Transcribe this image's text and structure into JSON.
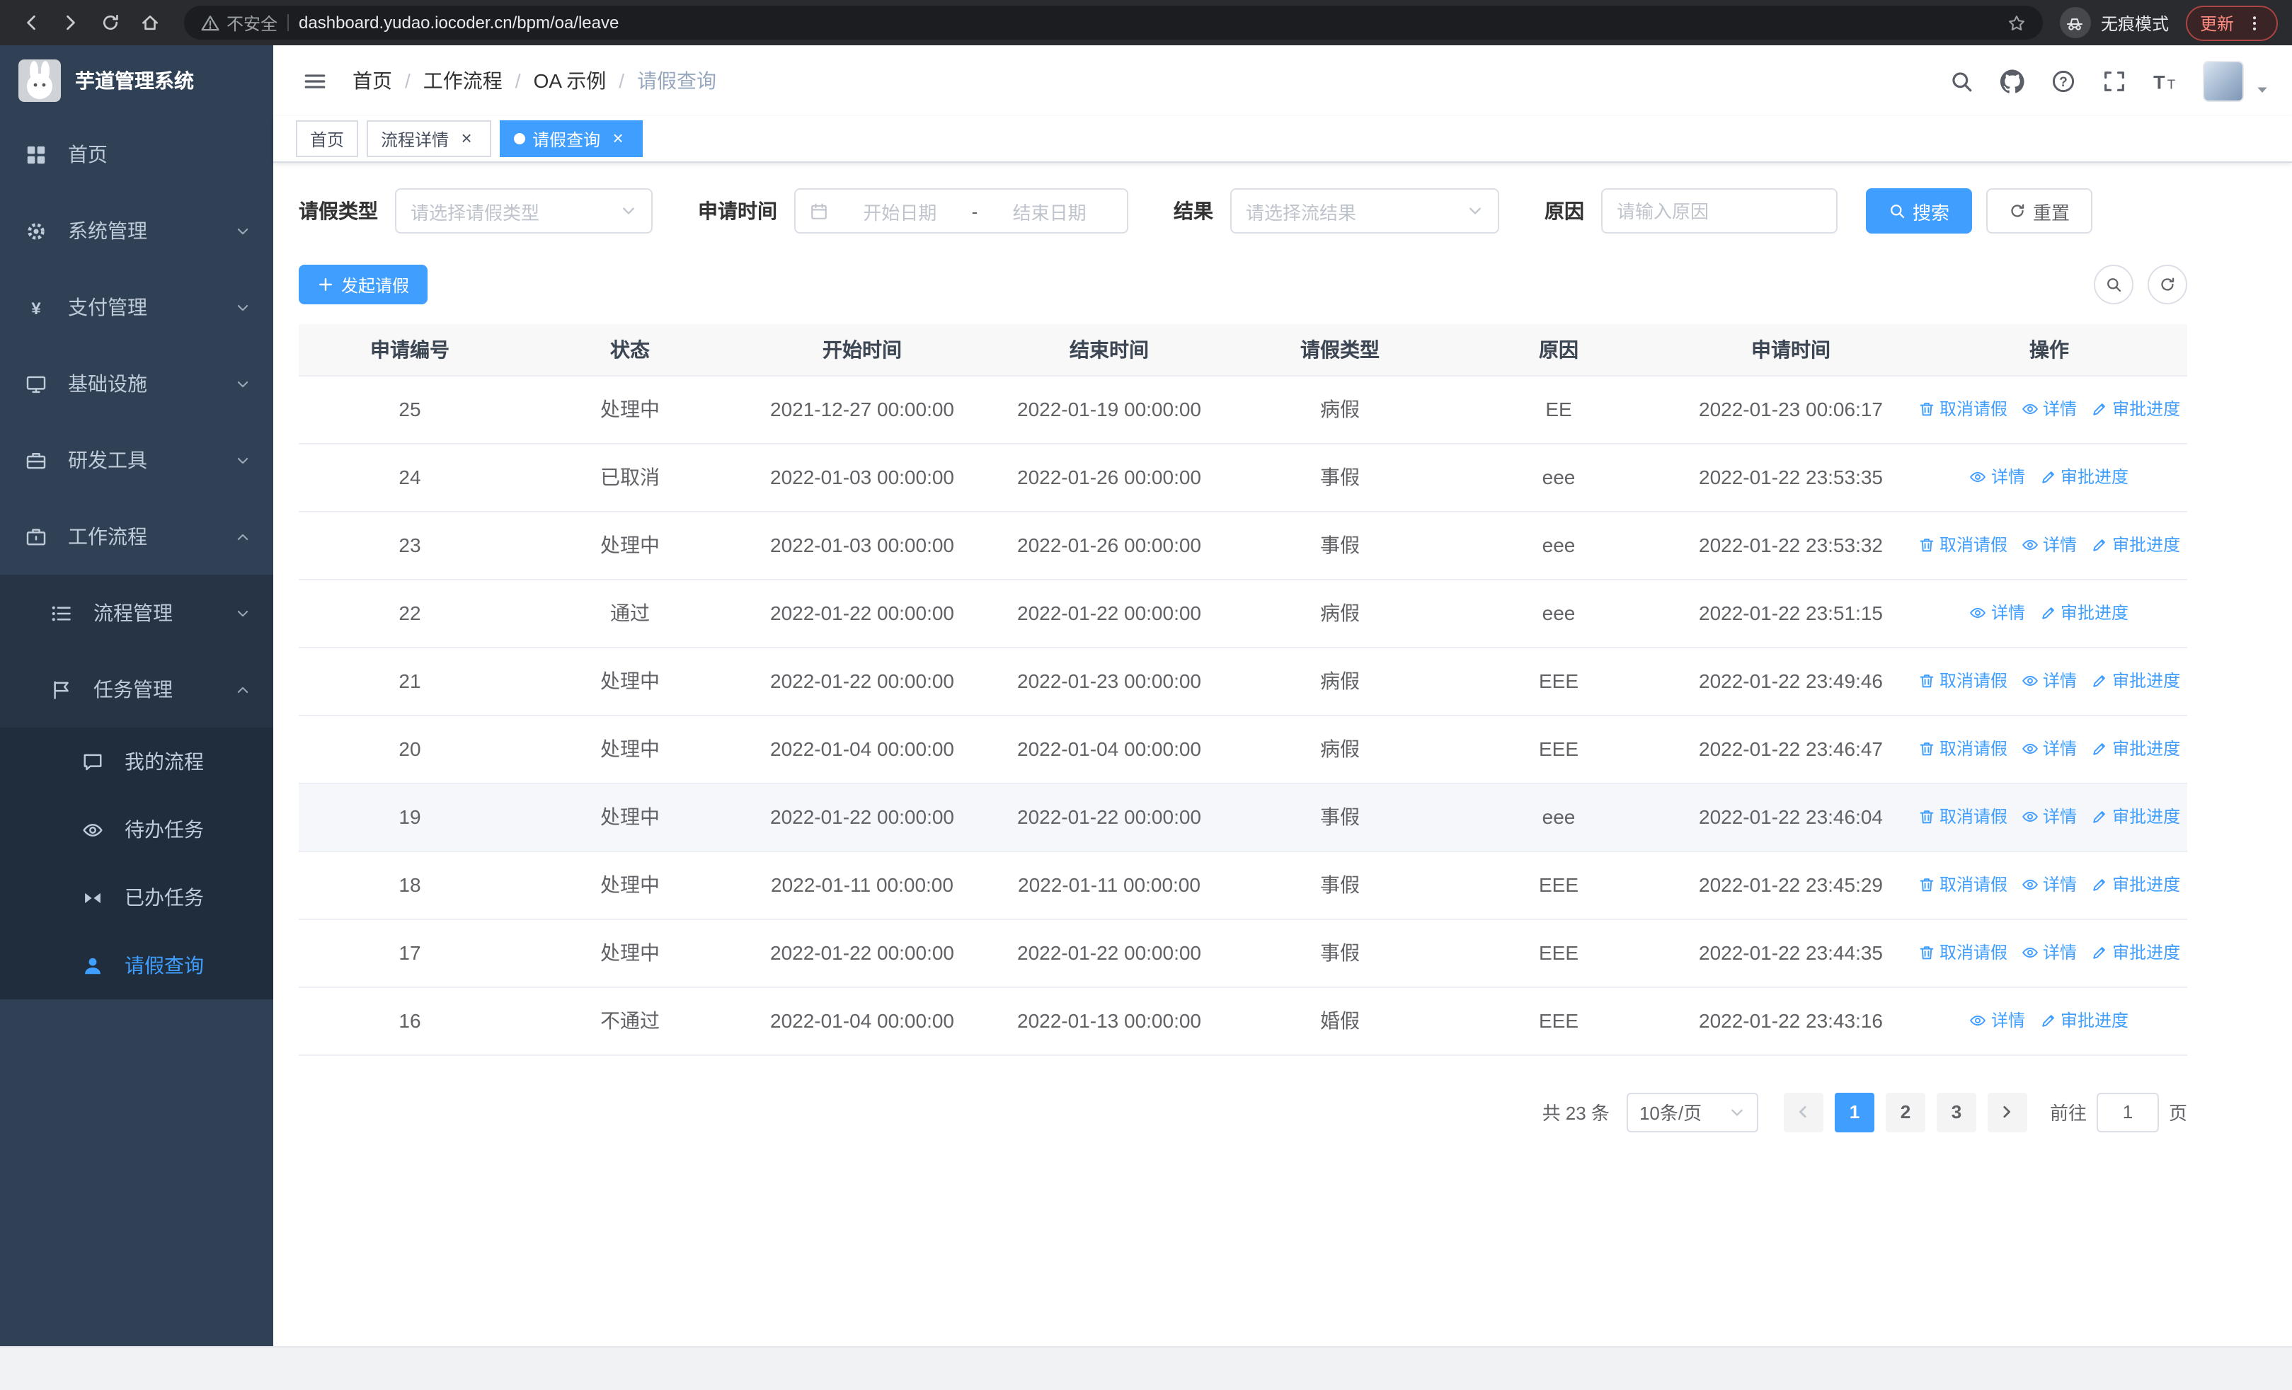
{
  "browser": {
    "security_label": "不安全",
    "url": "dashboard.yudao.iocoder.cn/bpm/oa/leave",
    "incognito_label": "无痕模式",
    "update_label": "更新"
  },
  "sidebar": {
    "logo_title": "芋道管理系统",
    "items": [
      {
        "label": "首页"
      },
      {
        "label": "系统管理"
      },
      {
        "label": "支付管理"
      },
      {
        "label": "基础设施"
      },
      {
        "label": "研发工具"
      },
      {
        "label": "工作流程"
      }
    ],
    "workflow_children": [
      {
        "label": "流程管理"
      },
      {
        "label": "任务管理"
      }
    ],
    "task_children": [
      {
        "label": "我的流程"
      },
      {
        "label": "待办任务"
      },
      {
        "label": "已办任务"
      },
      {
        "label": "请假查询"
      }
    ]
  },
  "header": {
    "breadcrumb": [
      "首页",
      "工作流程",
      "OA 示例",
      "请假查询"
    ]
  },
  "tabs": [
    {
      "label": "首页"
    },
    {
      "label": "流程详情"
    },
    {
      "label": "请假查询"
    }
  ],
  "filters": {
    "leave_type_label": "请假类型",
    "leave_type_placeholder": "请选择请假类型",
    "apply_time_label": "申请时间",
    "start_date_placeholder": "开始日期",
    "range_separator": "-",
    "end_date_placeholder": "结束日期",
    "result_label": "结果",
    "result_placeholder": "请选择流结果",
    "reason_label": "原因",
    "reason_placeholder": "请输入原因",
    "search_button": "搜索",
    "reset_button": "重置"
  },
  "toolbar": {
    "create_button": "发起请假"
  },
  "table": {
    "columns": [
      "申请编号",
      "状态",
      "开始时间",
      "结束时间",
      "请假类型",
      "原因",
      "申请时间",
      "操作"
    ],
    "action_labels": {
      "cancel": "取消请假",
      "detail": "详情",
      "progress": "审批进度"
    },
    "rows": [
      {
        "id": "25",
        "status": "处理中",
        "start": "2021-12-27 00:00:00",
        "end": "2022-01-19 00:00:00",
        "type": "病假",
        "reason": "EE",
        "applied": "2022-01-23 00:06:17",
        "actions": [
          "cancel",
          "detail",
          "progress"
        ]
      },
      {
        "id": "24",
        "status": "已取消",
        "start": "2022-01-03 00:00:00",
        "end": "2022-01-26 00:00:00",
        "type": "事假",
        "reason": "eee",
        "applied": "2022-01-22 23:53:35",
        "actions": [
          "detail",
          "progress"
        ]
      },
      {
        "id": "23",
        "status": "处理中",
        "start": "2022-01-03 00:00:00",
        "end": "2022-01-26 00:00:00",
        "type": "事假",
        "reason": "eee",
        "applied": "2022-01-22 23:53:32",
        "actions": [
          "cancel",
          "detail",
          "progress"
        ]
      },
      {
        "id": "22",
        "status": "通过",
        "start": "2022-01-22 00:00:00",
        "end": "2022-01-22 00:00:00",
        "type": "病假",
        "reason": "eee",
        "applied": "2022-01-22 23:51:15",
        "actions": [
          "detail",
          "progress"
        ]
      },
      {
        "id": "21",
        "status": "处理中",
        "start": "2022-01-22 00:00:00",
        "end": "2022-01-23 00:00:00",
        "type": "病假",
        "reason": "EEE",
        "applied": "2022-01-22 23:49:46",
        "actions": [
          "cancel",
          "detail",
          "progress"
        ]
      },
      {
        "id": "20",
        "status": "处理中",
        "start": "2022-01-04 00:00:00",
        "end": "2022-01-04 00:00:00",
        "type": "病假",
        "reason": "EEE",
        "applied": "2022-01-22 23:46:47",
        "actions": [
          "cancel",
          "detail",
          "progress"
        ]
      },
      {
        "id": "19",
        "status": "处理中",
        "start": "2022-01-22 00:00:00",
        "end": "2022-01-22 00:00:00",
        "type": "事假",
        "reason": "eee",
        "applied": "2022-01-22 23:46:04",
        "actions": [
          "cancel",
          "detail",
          "progress"
        ],
        "highlighted": true
      },
      {
        "id": "18",
        "status": "处理中",
        "start": "2022-01-11 00:00:00",
        "end": "2022-01-11 00:00:00",
        "type": "事假",
        "reason": "EEE",
        "applied": "2022-01-22 23:45:29",
        "actions": [
          "cancel",
          "detail",
          "progress"
        ]
      },
      {
        "id": "17",
        "status": "处理中",
        "start": "2022-01-22 00:00:00",
        "end": "2022-01-22 00:00:00",
        "type": "事假",
        "reason": "EEE",
        "applied": "2022-01-22 23:44:35",
        "actions": [
          "cancel",
          "detail",
          "progress"
        ]
      },
      {
        "id": "16",
        "status": "不通过",
        "start": "2022-01-04 00:00:00",
        "end": "2022-01-13 00:00:00",
        "type": "婚假",
        "reason": "EEE",
        "applied": "2022-01-22 23:43:16",
        "actions": [
          "detail",
          "progress"
        ]
      }
    ]
  },
  "pagination": {
    "total": "共 23 条",
    "page_size": "10条/页",
    "pages": [
      "1",
      "2",
      "3"
    ],
    "active_page": "1",
    "goto_label": "前往",
    "goto_value": "1",
    "goto_suffix": "页"
  },
  "colors": {
    "accent": "#409eff",
    "sidebar_bg": "#304156",
    "sidebar_sub_bg": "#263445",
    "sidebar_subsub_bg": "#1f2d3d"
  }
}
